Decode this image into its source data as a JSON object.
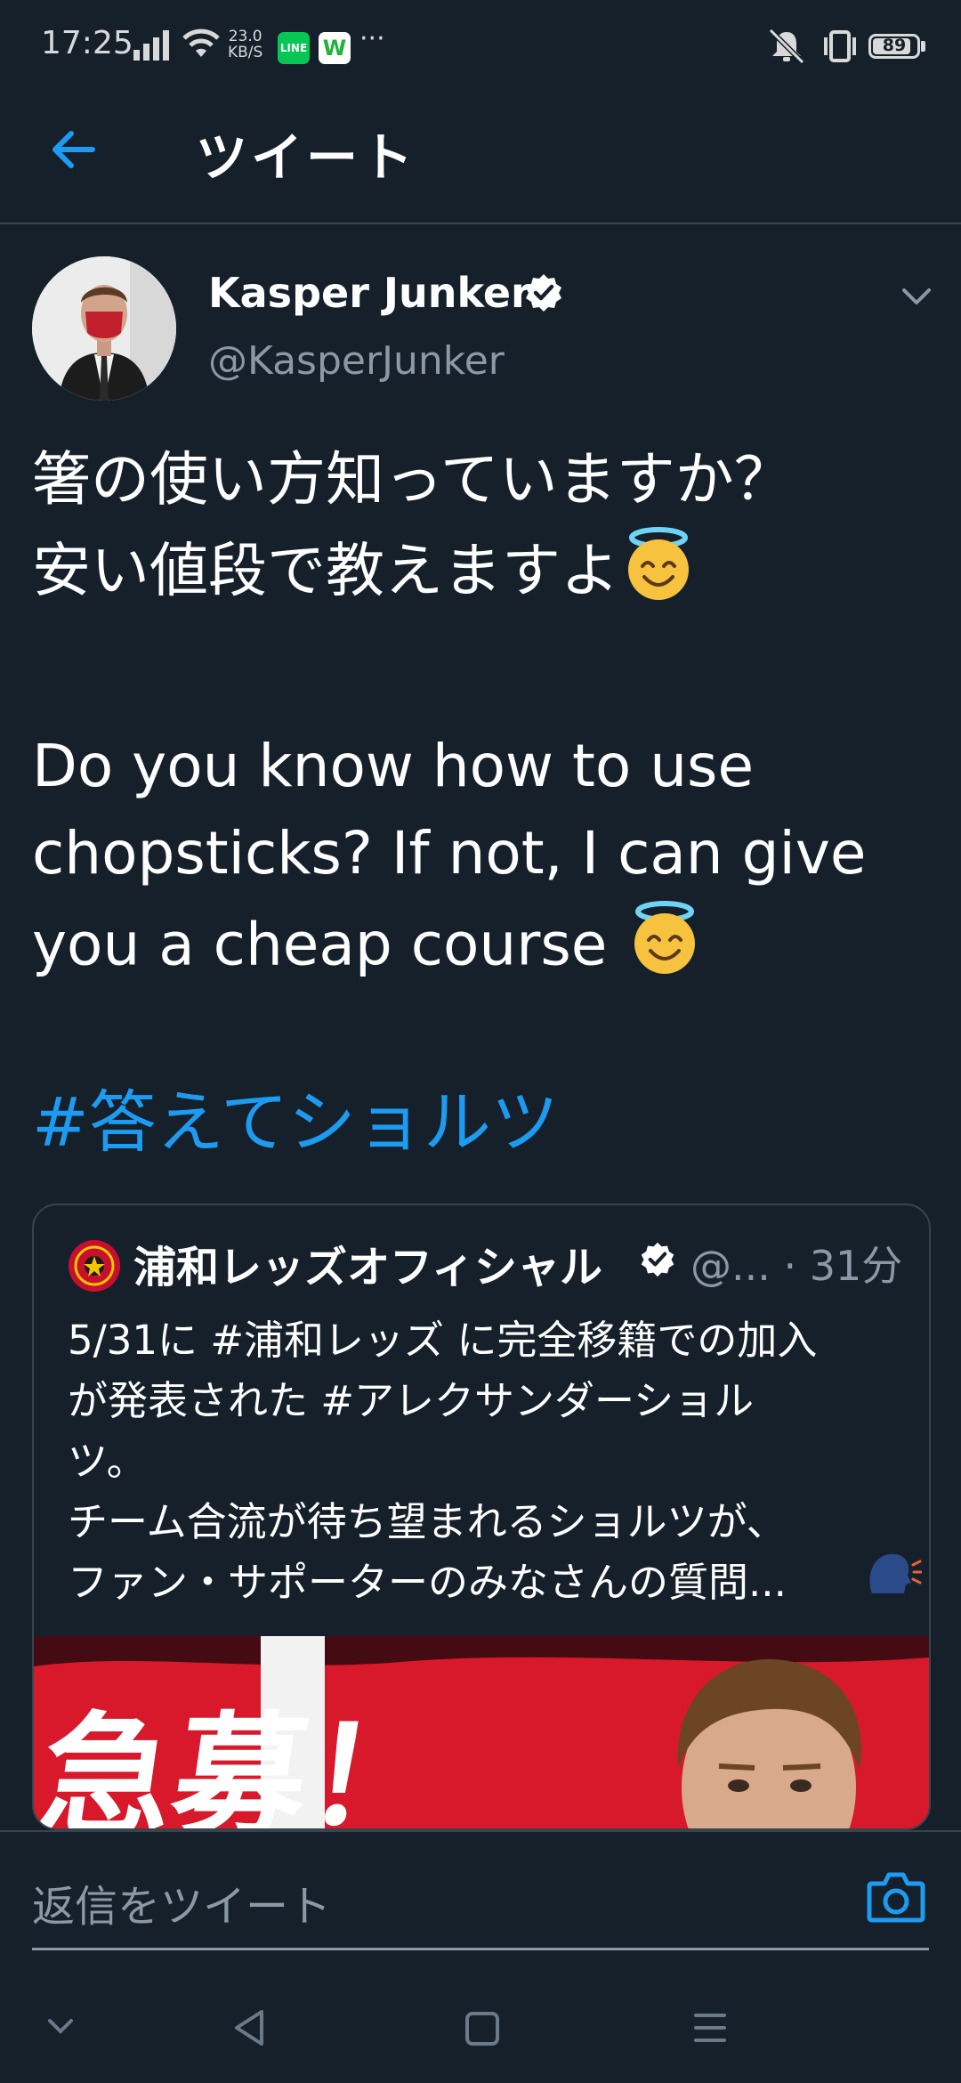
{
  "status_bar": {
    "time": "17:25",
    "speed_value": "23.0",
    "speed_unit": "KB/S",
    "line_icon_label": "LINE",
    "w_icon_label": "W",
    "more": "···",
    "battery": "89"
  },
  "header": {
    "title": "ツイート"
  },
  "tweet": {
    "author_name": "Kasper Junker",
    "author_handle": "@KasperJunker",
    "text_jp_line1": "箸の使い方知っていますか？",
    "text_jp_line2": "安い値段で教えますよ",
    "text_en_line1": "Do you know how to use",
    "text_en_line2": "chopsticks? If not, I can give",
    "text_en_line3": "you a cheap course ",
    "hashtag": "#答えてショルツ"
  },
  "quote": {
    "name": "浦和レッズオフィシャル",
    "meta": "@... · 31分",
    "text": "5/31に #浦和レッズ に完全移籍での加入\nが発表された #アレクサンダーショル\nツ。\nチーム合流が待ち望まれるショルツが、\nファン・サポーターのみなさんの質問...",
    "image_text": "急募！"
  },
  "reply": {
    "placeholder": "返信をツイート"
  },
  "colors": {
    "background": "#15202b",
    "accent": "#1d9bf0",
    "secondary_text": "#8b98a5",
    "divider": "#38444d"
  },
  "icons": {
    "back": "back-arrow-icon",
    "verified": "verified-badge-icon",
    "chevron": "chevron-down-icon",
    "camera": "camera-icon",
    "emoji": "smiling-face-with-halo"
  }
}
